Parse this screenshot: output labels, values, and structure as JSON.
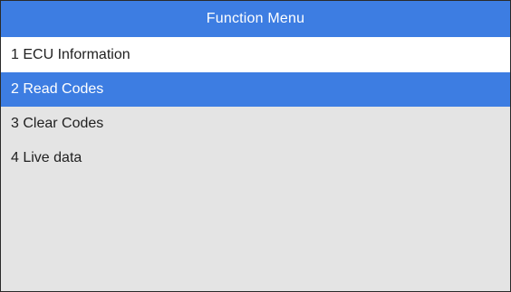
{
  "header": {
    "title": "Function Menu"
  },
  "menu": {
    "items": [
      {
        "label": "1 ECU Information"
      },
      {
        "label": "2 Read Codes",
        "selected": true
      },
      {
        "label": "3 Clear Codes"
      },
      {
        "label": "4 Live data"
      }
    ]
  },
  "colors": {
    "accent": "#3d7de2",
    "list_background": "#e4e4e4",
    "text": "#1f1f1f"
  }
}
